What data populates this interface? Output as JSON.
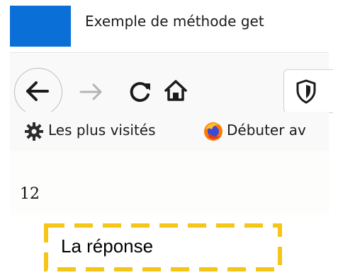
{
  "tab": {
    "title": "Exemple de méthode get",
    "accent_color": "#0a6fd6"
  },
  "navbar": {
    "icons": [
      "arrow-left-icon",
      "arrow-right-icon",
      "reload-icon",
      "home-icon",
      "shield-icon"
    ]
  },
  "bookmarks": {
    "items": [
      {
        "icon": "gear-icon",
        "label": "Les plus visités"
      },
      {
        "icon": "firefox-icon",
        "label": "Débuter av"
      }
    ]
  },
  "content": {
    "value": "12"
  },
  "annotation": {
    "label": "La réponse",
    "border_color": "#f5c518"
  }
}
